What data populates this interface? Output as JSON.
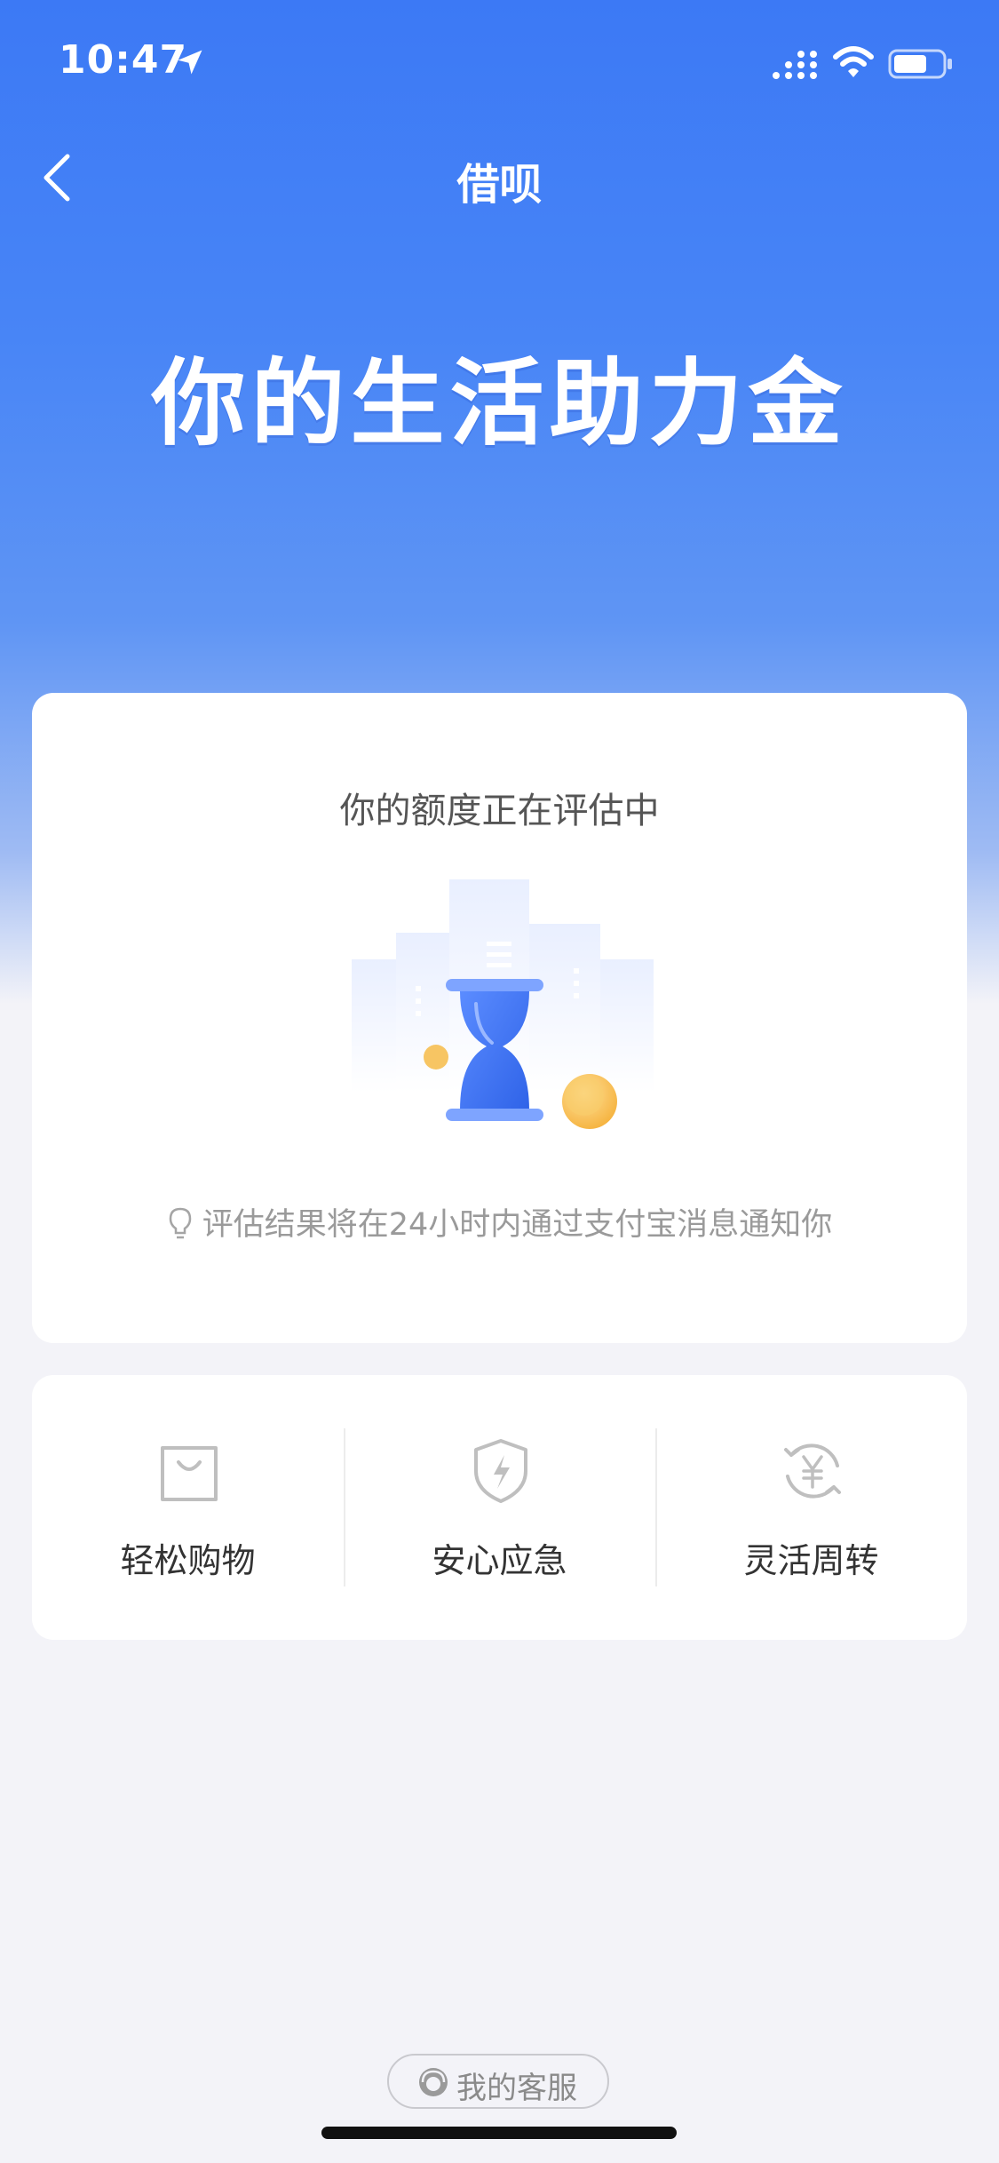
{
  "status_bar": {
    "time": "10:47"
  },
  "nav": {
    "title": "借呗"
  },
  "hero": {
    "slogan": "你的生活助力金"
  },
  "card": {
    "title": "你的额度正在评估中",
    "notice": "评估结果将在24小时内通过支付宝消息通知你"
  },
  "features": [
    {
      "label": "轻松购物",
      "icon": "shopping-bag-icon"
    },
    {
      "label": "安心应急",
      "icon": "shield-lightning-icon"
    },
    {
      "label": "灵活周转",
      "icon": "yuan-cycle-icon"
    }
  ],
  "footer": {
    "service_label": "我的客服"
  },
  "colors": {
    "accent": "#3c79f5",
    "card": "#ffffff",
    "page_bg": "#f3f3f8"
  }
}
